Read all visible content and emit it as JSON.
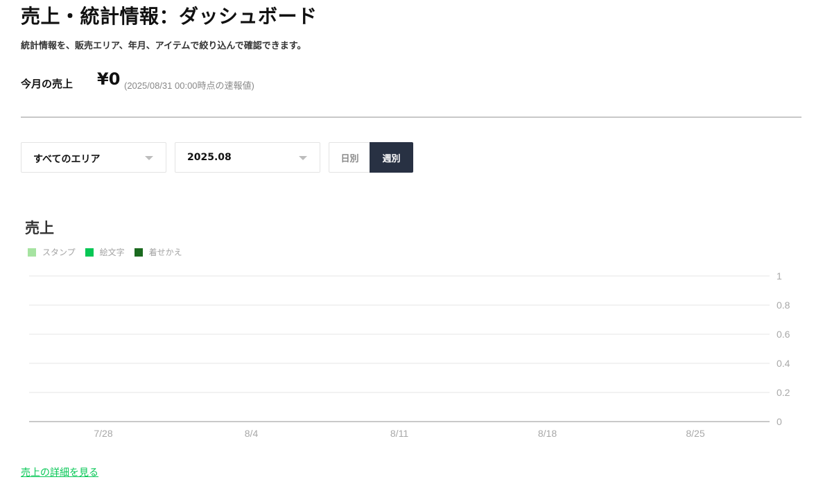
{
  "header": {
    "title": "売上・統計情報：ダッシュボード",
    "subtitle": "統計情報を、販売エリア、年月、アイテムで絞り込んで確認できます。"
  },
  "month_sales": {
    "label": "今月の売上",
    "value": "¥0",
    "note": "(2025/08/31 00:00時点の速報値)"
  },
  "filters": {
    "area": "すべてのエリア",
    "month": "2025.08",
    "period_daily": "日別",
    "period_weekly": "週別",
    "selected_period": "週別"
  },
  "chart_data": {
    "type": "bar",
    "title": "売上",
    "categories": [
      "7/28",
      "8/4",
      "8/11",
      "8/18",
      "8/25"
    ],
    "series": [
      {
        "name": "スタンプ",
        "color": "#a6e3a1",
        "values": [
          0,
          0,
          0,
          0,
          0
        ]
      },
      {
        "name": "絵文字",
        "color": "#06c755",
        "values": [
          0,
          0,
          0,
          0,
          0
        ]
      },
      {
        "name": "着せかえ",
        "color": "#1b6a1f",
        "values": [
          0,
          0,
          0,
          0,
          0
        ]
      }
    ],
    "y_ticks": [
      "1",
      "0.8",
      "0.6",
      "0.4",
      "0.2",
      "0"
    ],
    "ylim": [
      0,
      1
    ],
    "grid": true,
    "y_axis_position": "right",
    "legend_position": "top-left"
  },
  "footer": {
    "detail_link": "売上の詳細を見る"
  }
}
